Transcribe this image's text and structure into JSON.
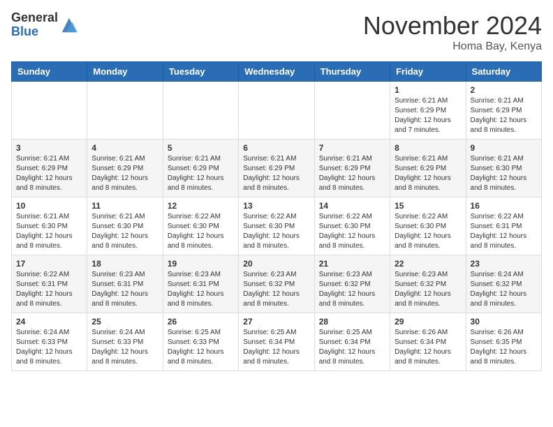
{
  "header": {
    "logo_general": "General",
    "logo_blue": "Blue",
    "month_title": "November 2024",
    "location": "Homa Bay, Kenya"
  },
  "calendar": {
    "days_of_week": [
      "Sunday",
      "Monday",
      "Tuesday",
      "Wednesday",
      "Thursday",
      "Friday",
      "Saturday"
    ],
    "weeks": [
      [
        {
          "day": "",
          "info": ""
        },
        {
          "day": "",
          "info": ""
        },
        {
          "day": "",
          "info": ""
        },
        {
          "day": "",
          "info": ""
        },
        {
          "day": "",
          "info": ""
        },
        {
          "day": "1",
          "info": "Sunrise: 6:21 AM\nSunset: 6:29 PM\nDaylight: 12 hours and 7 minutes."
        },
        {
          "day": "2",
          "info": "Sunrise: 6:21 AM\nSunset: 6:29 PM\nDaylight: 12 hours and 8 minutes."
        }
      ],
      [
        {
          "day": "3",
          "info": "Sunrise: 6:21 AM\nSunset: 6:29 PM\nDaylight: 12 hours and 8 minutes."
        },
        {
          "day": "4",
          "info": "Sunrise: 6:21 AM\nSunset: 6:29 PM\nDaylight: 12 hours and 8 minutes."
        },
        {
          "day": "5",
          "info": "Sunrise: 6:21 AM\nSunset: 6:29 PM\nDaylight: 12 hours and 8 minutes."
        },
        {
          "day": "6",
          "info": "Sunrise: 6:21 AM\nSunset: 6:29 PM\nDaylight: 12 hours and 8 minutes."
        },
        {
          "day": "7",
          "info": "Sunrise: 6:21 AM\nSunset: 6:29 PM\nDaylight: 12 hours and 8 minutes."
        },
        {
          "day": "8",
          "info": "Sunrise: 6:21 AM\nSunset: 6:29 PM\nDaylight: 12 hours and 8 minutes."
        },
        {
          "day": "9",
          "info": "Sunrise: 6:21 AM\nSunset: 6:30 PM\nDaylight: 12 hours and 8 minutes."
        }
      ],
      [
        {
          "day": "10",
          "info": "Sunrise: 6:21 AM\nSunset: 6:30 PM\nDaylight: 12 hours and 8 minutes."
        },
        {
          "day": "11",
          "info": "Sunrise: 6:21 AM\nSunset: 6:30 PM\nDaylight: 12 hours and 8 minutes."
        },
        {
          "day": "12",
          "info": "Sunrise: 6:22 AM\nSunset: 6:30 PM\nDaylight: 12 hours and 8 minutes."
        },
        {
          "day": "13",
          "info": "Sunrise: 6:22 AM\nSunset: 6:30 PM\nDaylight: 12 hours and 8 minutes."
        },
        {
          "day": "14",
          "info": "Sunrise: 6:22 AM\nSunset: 6:30 PM\nDaylight: 12 hours and 8 minutes."
        },
        {
          "day": "15",
          "info": "Sunrise: 6:22 AM\nSunset: 6:30 PM\nDaylight: 12 hours and 8 minutes."
        },
        {
          "day": "16",
          "info": "Sunrise: 6:22 AM\nSunset: 6:31 PM\nDaylight: 12 hours and 8 minutes."
        }
      ],
      [
        {
          "day": "17",
          "info": "Sunrise: 6:22 AM\nSunset: 6:31 PM\nDaylight: 12 hours and 8 minutes."
        },
        {
          "day": "18",
          "info": "Sunrise: 6:23 AM\nSunset: 6:31 PM\nDaylight: 12 hours and 8 minutes."
        },
        {
          "day": "19",
          "info": "Sunrise: 6:23 AM\nSunset: 6:31 PM\nDaylight: 12 hours and 8 minutes."
        },
        {
          "day": "20",
          "info": "Sunrise: 6:23 AM\nSunset: 6:32 PM\nDaylight: 12 hours and 8 minutes."
        },
        {
          "day": "21",
          "info": "Sunrise: 6:23 AM\nSunset: 6:32 PM\nDaylight: 12 hours and 8 minutes."
        },
        {
          "day": "22",
          "info": "Sunrise: 6:23 AM\nSunset: 6:32 PM\nDaylight: 12 hours and 8 minutes."
        },
        {
          "day": "23",
          "info": "Sunrise: 6:24 AM\nSunset: 6:32 PM\nDaylight: 12 hours and 8 minutes."
        }
      ],
      [
        {
          "day": "24",
          "info": "Sunrise: 6:24 AM\nSunset: 6:33 PM\nDaylight: 12 hours and 8 minutes."
        },
        {
          "day": "25",
          "info": "Sunrise: 6:24 AM\nSunset: 6:33 PM\nDaylight: 12 hours and 8 minutes."
        },
        {
          "day": "26",
          "info": "Sunrise: 6:25 AM\nSunset: 6:33 PM\nDaylight: 12 hours and 8 minutes."
        },
        {
          "day": "27",
          "info": "Sunrise: 6:25 AM\nSunset: 6:34 PM\nDaylight: 12 hours and 8 minutes."
        },
        {
          "day": "28",
          "info": "Sunrise: 6:25 AM\nSunset: 6:34 PM\nDaylight: 12 hours and 8 minutes."
        },
        {
          "day": "29",
          "info": "Sunrise: 6:26 AM\nSunset: 6:34 PM\nDaylight: 12 hours and 8 minutes."
        },
        {
          "day": "30",
          "info": "Sunrise: 6:26 AM\nSunset: 6:35 PM\nDaylight: 12 hours and 8 minutes."
        }
      ]
    ]
  }
}
